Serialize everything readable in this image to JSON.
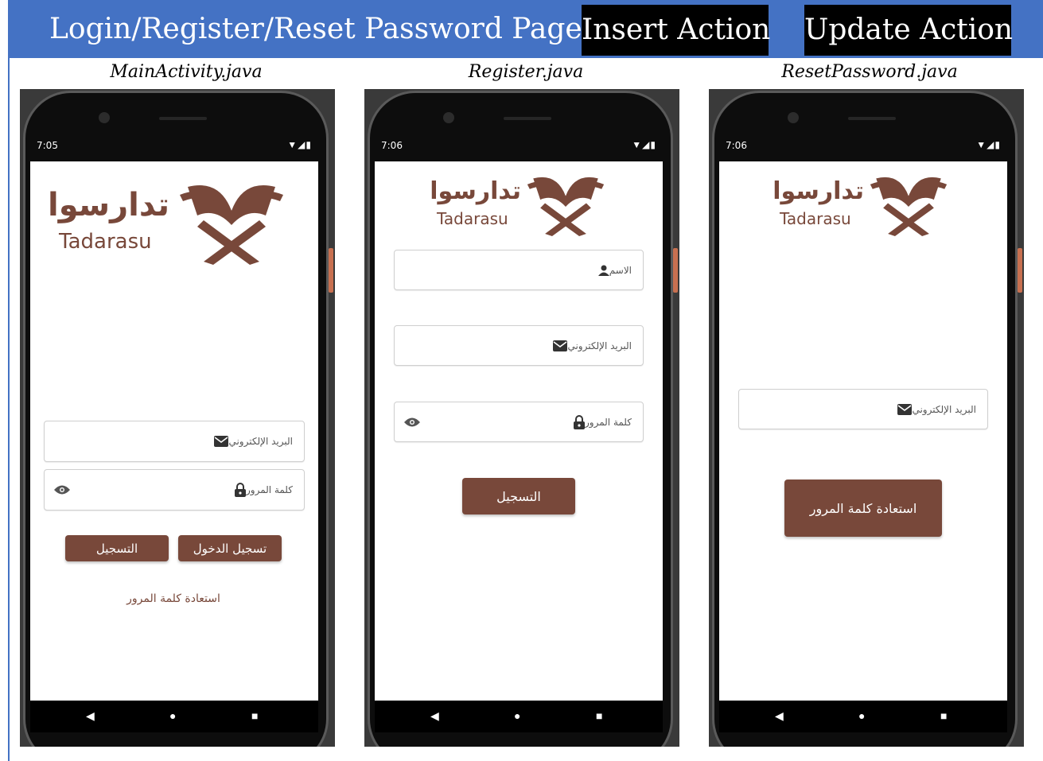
{
  "header": {
    "title": "Login/Register/Reset Password Pages",
    "insert_badge": "Insert Action",
    "update_badge": "Update Action"
  },
  "colors": {
    "header_bg": "#4472c4",
    "brand_brown": "#78483a"
  },
  "screens": [
    {
      "caption": "MainActivity.java",
      "status_time": "7:05",
      "logo_ar": "تدارسوا",
      "logo_en": "Tadarasu",
      "email_label": "البريد الإلكتروني",
      "password_label": "كلمة المرور",
      "login_button": "تسجيل الدخول",
      "register_button": "التسجيل",
      "reset_link": "استعادة كلمة المرور"
    },
    {
      "caption": "Register.java",
      "status_time": "7:06",
      "logo_ar": "تدارسوا",
      "logo_en": "Tadarasu",
      "name_label": "الاسم",
      "email_label": "البريد الإلكتروني",
      "password_label": "كلمة المرور",
      "register_button": "التسجيل"
    },
    {
      "caption": "ResetPassword.java",
      "status_time": "7:06",
      "logo_ar": "تدارسوا",
      "logo_en": "Tadarasu",
      "email_label": "البريد الإلكتروني",
      "reset_button": "استعادة كلمة المرور"
    }
  ],
  "icons": [
    "wifi-icon",
    "signal-icon",
    "battery-icon",
    "person-icon",
    "mail-icon",
    "lock-icon",
    "eye-icon",
    "back-icon",
    "home-icon",
    "recents-icon",
    "book-logo-icon"
  ]
}
